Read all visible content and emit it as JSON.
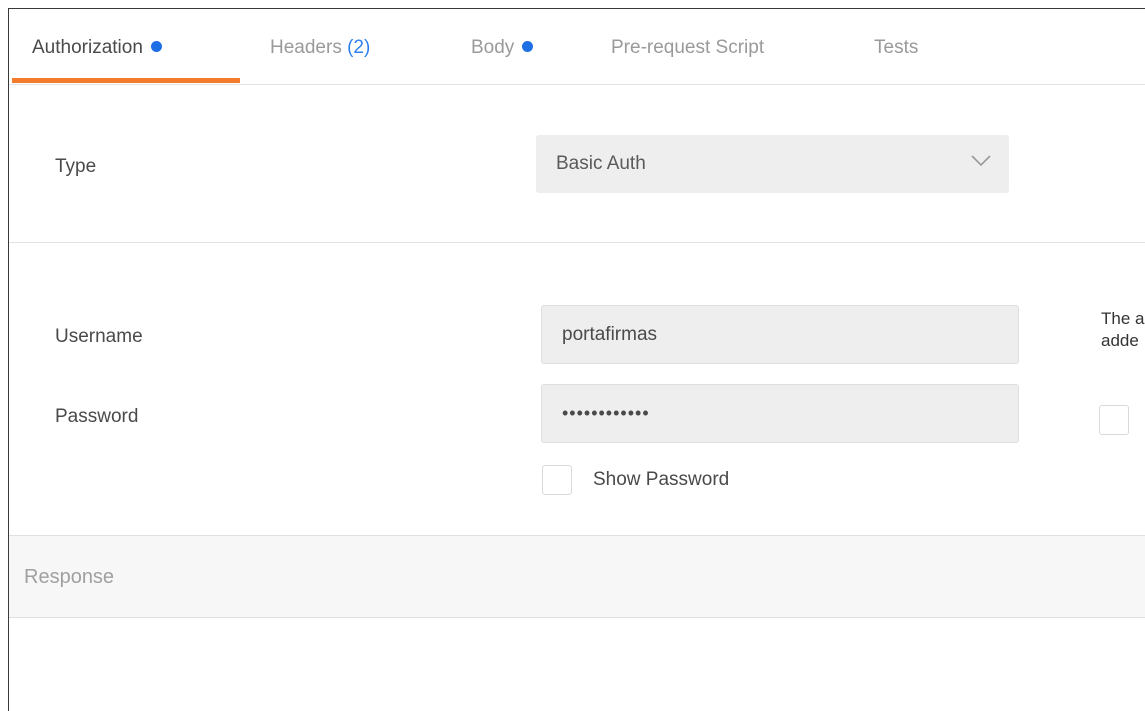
{
  "colors": {
    "accent": "#2f80ed",
    "dot": "#1e6fe6",
    "underline": "#f37b2b"
  },
  "tabs": [
    {
      "label": "Authorization",
      "active": true,
      "dot": true
    },
    {
      "label": "Headers",
      "count": "(2)",
      "active": false
    },
    {
      "label": "Body",
      "active": false,
      "dot": true
    },
    {
      "label": "Pre-request Script",
      "active": false
    },
    {
      "label": "Tests",
      "active": false
    }
  ],
  "auth": {
    "type_label": "Type",
    "type_value": "Basic Auth",
    "username_label": "Username",
    "username_value": "portafirmas",
    "password_label": "Password",
    "password_value": "••••••••••••",
    "show_password_label": "Show Password",
    "show_password_checked": false,
    "help_text_line1": "The a",
    "help_text_line2": "adde"
  },
  "response": {
    "label": "Response"
  }
}
